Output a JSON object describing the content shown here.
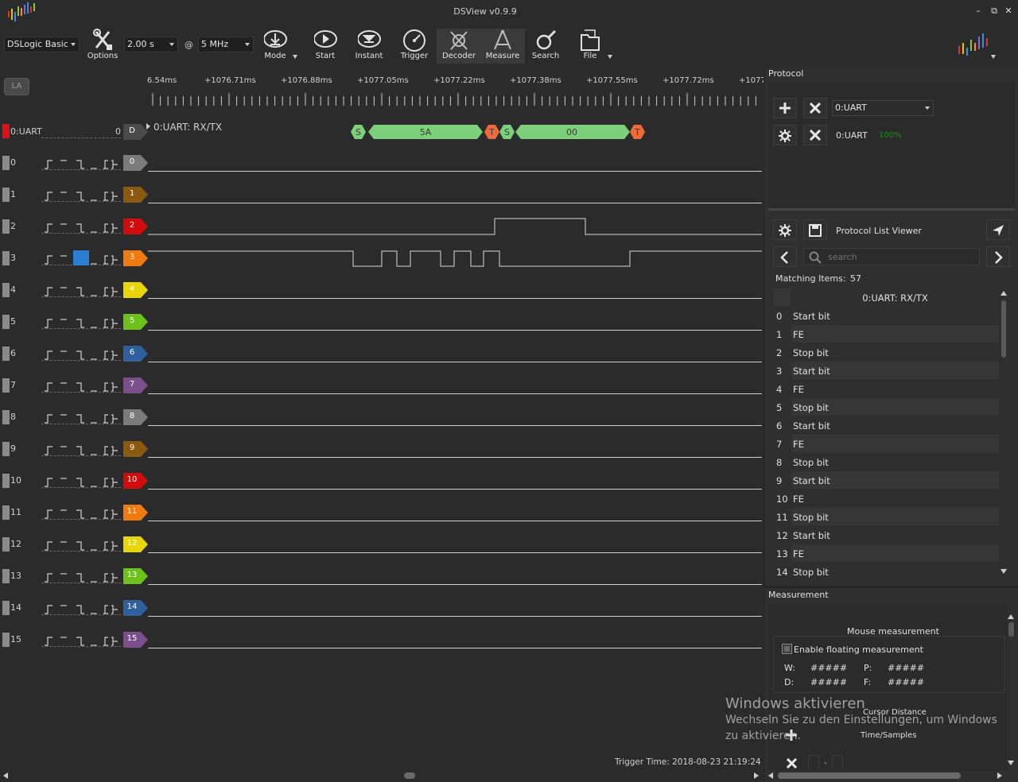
{
  "window": {
    "title": "DSView v0.9.9",
    "minimize": "–",
    "restore": "⧉",
    "close": "✕"
  },
  "toolbar": {
    "device": "DSLogic Basic",
    "duration": "2.00 s",
    "at": "@",
    "samplerate": "5 MHz",
    "options_label": "Options",
    "mode_label": "Mode",
    "start_label": "Start",
    "instant_label": "Instant",
    "trigger_label": "Trigger",
    "decoder_label": "Decoder",
    "measure_label": "Measure",
    "search_label": "Search",
    "file_label": "File"
  },
  "view": {
    "la_button": "LA",
    "ticks": [
      "6.54ms",
      "+1076.71ms",
      "+1076.88ms",
      "+1077.05ms",
      "+1077.22ms",
      "+1077.38ms",
      "+1077.55ms",
      "+1077.72ms",
      "+1077"
    ],
    "decoder_channel_name": "0:UART",
    "decoder_channel_value": "0",
    "decoder_tag": "D",
    "decoder_row_label": "0:UART: RX/TX",
    "decode_marks": [
      "S",
      "5A",
      "T",
      "S",
      "00",
      "T"
    ],
    "trigger_time": "Trigger Time: 2018-08-23 21:19:24 Do"
  },
  "channels": [
    {
      "num": "0",
      "tag": "0",
      "color": "#7b7b7b"
    },
    {
      "num": "1",
      "tag": "1",
      "color": "#8b5a10"
    },
    {
      "num": "2",
      "tag": "2",
      "color": "#d10c0c"
    },
    {
      "num": "3",
      "tag": "3",
      "color": "#f07a10"
    },
    {
      "num": "4",
      "tag": "4",
      "color": "#e8d60a"
    },
    {
      "num": "5",
      "tag": "5",
      "color": "#6cc21a"
    },
    {
      "num": "6",
      "tag": "6",
      "color": "#2f5f9c"
    },
    {
      "num": "7",
      "tag": "7",
      "color": "#7a4f8c"
    },
    {
      "num": "8",
      "tag": "8",
      "color": "#7b7b7b"
    },
    {
      "num": "9",
      "tag": "9",
      "color": "#8b5a10"
    },
    {
      "num": "10",
      "tag": "10",
      "color": "#d10c0c"
    },
    {
      "num": "11",
      "tag": "11",
      "color": "#f07a10"
    },
    {
      "num": "12",
      "tag": "12",
      "color": "#e8d60a"
    },
    {
      "num": "13",
      "tag": "13",
      "color": "#6cc21a"
    },
    {
      "num": "14",
      "tag": "14",
      "color": "#2f5f9c"
    },
    {
      "num": "15",
      "tag": "15",
      "color": "#7a4f8c"
    }
  ],
  "protocol": {
    "header": "Protocol",
    "decoder_select": "0:UART",
    "decoder_name": "0:UART",
    "decoder_progress": "100%",
    "list_viewer_title": "Protocol List Viewer",
    "search_placeholder": "search",
    "matching_label": "Matching Items:",
    "matching_count": "57",
    "column_header": "0:UART: RX/TX",
    "rows": [
      {
        "idx": "0",
        "val": "Start bit"
      },
      {
        "idx": "1",
        "val": "FE"
      },
      {
        "idx": "2",
        "val": "Stop bit"
      },
      {
        "idx": "3",
        "val": "Start bit"
      },
      {
        "idx": "4",
        "val": "FE"
      },
      {
        "idx": "5",
        "val": "Stop bit"
      },
      {
        "idx": "6",
        "val": "Start bit"
      },
      {
        "idx": "7",
        "val": "FE"
      },
      {
        "idx": "8",
        "val": "Stop bit"
      },
      {
        "idx": "9",
        "val": "Start bit"
      },
      {
        "idx": "10",
        "val": "FE"
      },
      {
        "idx": "11",
        "val": "Stop bit"
      },
      {
        "idx": "12",
        "val": "Start bit"
      },
      {
        "idx": "13",
        "val": "FE"
      },
      {
        "idx": "14",
        "val": "Stop bit"
      }
    ]
  },
  "measurement": {
    "header": "Measurement",
    "mouse_title": "Mouse measurement",
    "floating_label": "Enable floating measurement",
    "w_label": "W:",
    "w_value": "#####",
    "p_label": "P:",
    "p_value": "#####",
    "d_label": "D:",
    "d_value": "#####",
    "f_label": "F:",
    "f_value": "#####",
    "cursor_distance": "Cursor Distance",
    "time_samples": "Time/Samples",
    "dash": "-"
  },
  "windows_activate": {
    "title": "Windows aktivieren",
    "line1": "Wechseln Sie zu den Einstellungen, um Windows",
    "line2": "zu aktivieren."
  }
}
